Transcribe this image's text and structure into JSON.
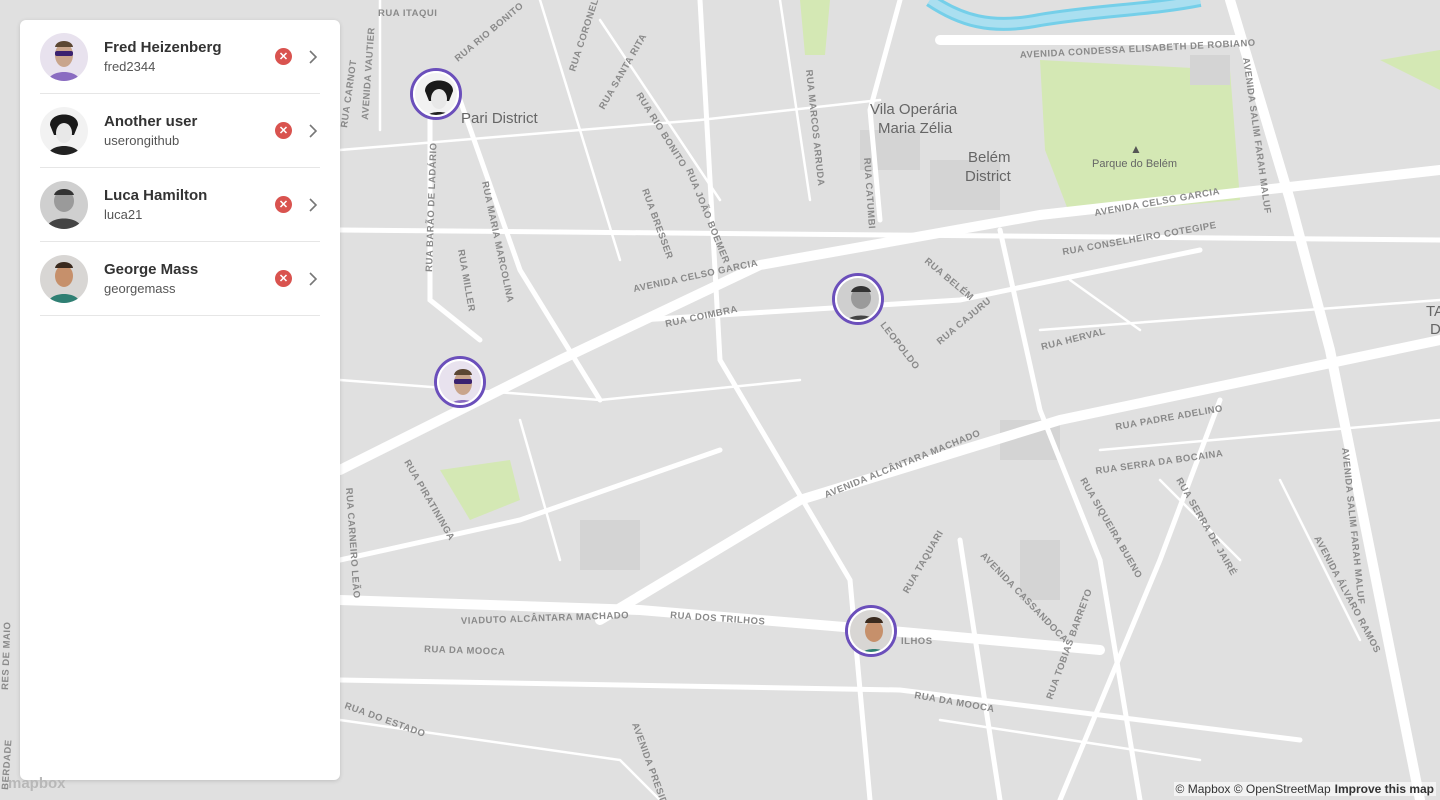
{
  "users": [
    {
      "name": "Fred Heizenberg",
      "handle": "fred2344"
    },
    {
      "name": "Another user",
      "handle": "userongithub"
    },
    {
      "name": "Luca Hamilton",
      "handle": "luca21"
    },
    {
      "name": "George Mass",
      "handle": "georgemass"
    }
  ],
  "map": {
    "districts": [
      "Pari District",
      "Vila Operária",
      "Maria Zélia",
      "Belém",
      "District"
    ],
    "park": "Parque do Belém",
    "streets": [
      "RUA ITAQUI",
      "RUA RIO BONITO",
      "RUA CORONEL EMÍDIO",
      "RUA SANTA RITA",
      "RUA RIO BONITO",
      "AVENIDA VAUTIER",
      "RUA CARNOT",
      "RUA MARCOS ARRUDA",
      "RUA CATUMBI",
      "AVENIDA CONDESSA ELISABETH DE ROBIANO",
      "AVENIDA SALIM FARAH MALUF",
      "AVENIDA CELSO GARCIA",
      "RUA CONSELHEIRO COTEGIPE",
      "RUA BARÃO DE LADÁRIO",
      "RUA MARIA MARCOLINA",
      "RUA MILLER",
      "RUA BRESSER",
      "RUA JOÃO BOEMER",
      "AVENIDA CELSO GARCIA",
      "RUA COIMBRA",
      "RUA BELÉM",
      "RUA CAJURU",
      "RUA HERVAL",
      "RUA PADRE ADELINO",
      "AVENIDA ALCÂNTARA MACHADO",
      "RUA SERRA DA BOCAINA",
      "RUA SIQUEIRA BUENO",
      "RUA SERRA DE JAIRÉ",
      "AVENIDA SALIM FARAH MALUF",
      "RUA PIRATININGA",
      "RUA CARNEIRO LEÃO",
      "VIADUTO ALCÂNTARA MACHADO",
      "RUA DOS TRILHOS",
      "RUA TAQUARI",
      "AVENIDA CASSANDOCA",
      "RUA TOBIAS BARRETO",
      "AVENIDA ÁLVARO RAMOS",
      "RUA DA MOOCA",
      "RUA DA MOOCA",
      "RUA DO ESTADO",
      "AVENIDA PRESIDENTE",
      "LEOPOLDO",
      "ILHOS",
      "TA",
      "D",
      "RES DE MAIO",
      "BERDADE"
    ]
  },
  "attribution": {
    "text": "© Mapbox © OpenStreetMap",
    "improve": "Improve this map",
    "logo": "mapbox"
  }
}
